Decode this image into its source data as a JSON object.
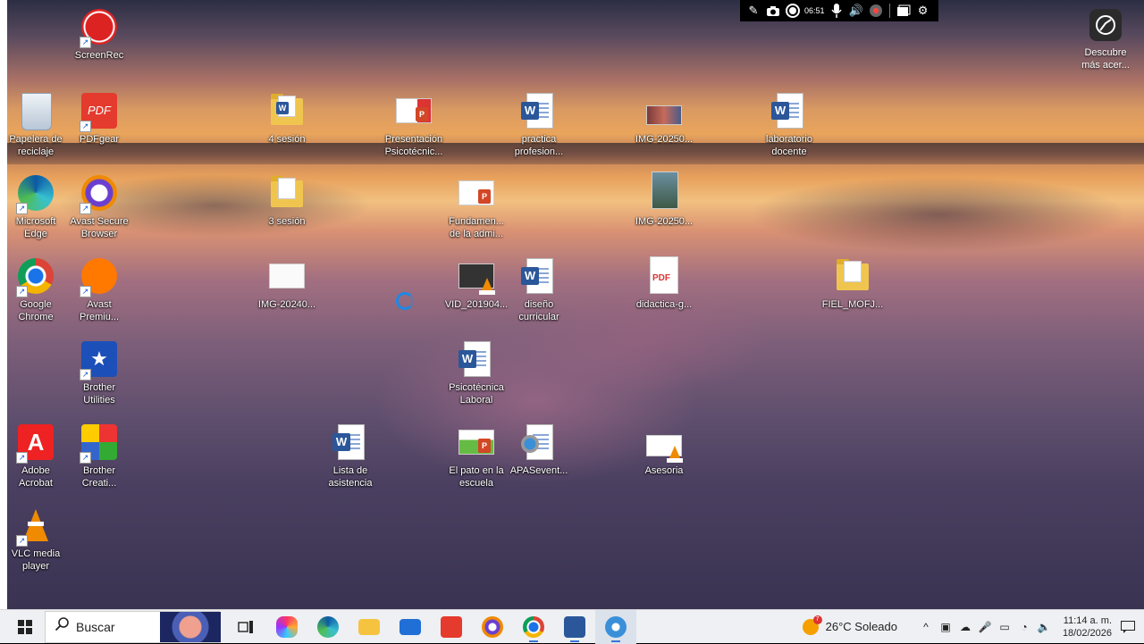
{
  "recorder_toolbar": {
    "timer": "06:51"
  },
  "discover": {
    "label": "Descubre más acer..."
  },
  "desktop_icons": [
    {
      "label": "ScreenRec"
    },
    {
      "label": "Papelera de reciclaje"
    },
    {
      "label": "PDFgear"
    },
    {
      "label": "Microsoft Edge"
    },
    {
      "label": "Avast Secure Browser"
    },
    {
      "label": "Google Chrome"
    },
    {
      "label": "Avast Premiu..."
    },
    {
      "label": "Brother Utilities"
    },
    {
      "label": "Adobe Acrobat"
    },
    {
      "label": "Brother Creati..."
    },
    {
      "label": "VLC media player"
    },
    {
      "label": "4 sesión"
    },
    {
      "label": "3 sesión"
    },
    {
      "label": "IMG-20240..."
    },
    {
      "label": "Lista de asistencia"
    },
    {
      "label": "Presentación Psicotécnic..."
    },
    {
      "label": "Fundamen... de la admi..."
    },
    {
      "label": "VID_201904..."
    },
    {
      "label": "Psicotécnica Laboral"
    },
    {
      "label": "El pato en la escuela"
    },
    {
      "label": "practica profesion..."
    },
    {
      "label": "diseño curricular"
    },
    {
      "label": "APASevent..."
    },
    {
      "label": "IMG-20250..."
    },
    {
      "label": "IMG-20250..."
    },
    {
      "label": "didactica-g..."
    },
    {
      "label": "Asesoria"
    },
    {
      "label": "laboratorio docente"
    },
    {
      "label": "FIEL_MOFJ..."
    }
  ],
  "taskbar": {
    "search_placeholder": "Buscar",
    "weather": "26°C  Soleado",
    "weather_badge": "7",
    "time": "11:14 a. m.",
    "date": "18/02/2026"
  }
}
